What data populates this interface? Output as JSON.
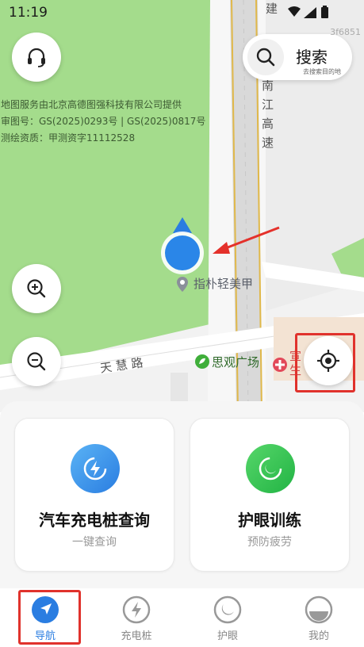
{
  "status_bar": {
    "time": "11:19",
    "code": "3f6851"
  },
  "search": {
    "label": "搜索",
    "hint": "去搜索目的地"
  },
  "attribution": {
    "line1": "地图服务由北京高德图强科技有限公司提供",
    "line2": "审图号：GS(2025)0293号 | GS(2025)0817号",
    "line3": "测绘资质：甲测资字11112528"
  },
  "map": {
    "road_vertical": "建",
    "road_vertical_2": "南江高速",
    "road_horizontal": "天 慧 路",
    "poi_1": "指朴轻美甲",
    "poi_2": "思观广场",
    "poi_3": "宣生"
  },
  "cards": [
    {
      "title": "汽车充电桩查询",
      "subtitle": "一键查询",
      "icon": "lightning-icon"
    },
    {
      "title": "护眼训练",
      "subtitle": "预防疲劳",
      "icon": "eye-icon"
    }
  ],
  "tabs": [
    {
      "label": "导航",
      "icon": "navigation-icon",
      "active": true
    },
    {
      "label": "充电桩",
      "icon": "charging-pile-icon",
      "active": false
    },
    {
      "label": "护眼",
      "icon": "eye-care-icon",
      "active": false
    },
    {
      "label": "我的",
      "icon": "profile-icon",
      "active": false
    }
  ],
  "colors": {
    "map_green": "#a4dc8c",
    "accent_blue": "#2a7de1",
    "accent_green": "#2fbf4a",
    "highlight_red": "#e0322c"
  }
}
